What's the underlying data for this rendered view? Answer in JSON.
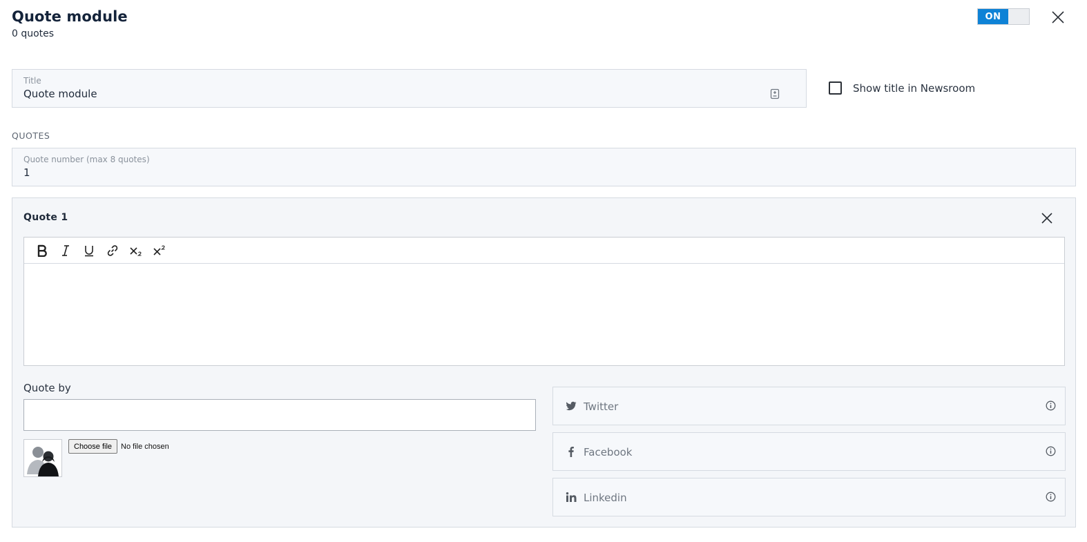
{
  "header": {
    "title": "Quote module",
    "subtitle": "0 quotes",
    "toggle_label": "ON"
  },
  "title_field": {
    "label": "Title",
    "value": "Quote module"
  },
  "show_title": {
    "label": "Show title in Newsroom",
    "checked": false
  },
  "quotes_section": {
    "label": "QUOTES",
    "number_field": {
      "label": "Quote number (max 8 quotes)",
      "value": "1"
    }
  },
  "quote": {
    "title": "Quote 1",
    "toolbar": [
      "bold-icon",
      "italic-icon",
      "underline-icon",
      "link-icon",
      "subscript-icon",
      "superscript-icon"
    ],
    "editor_text": "",
    "quote_by_label": "Quote by",
    "quote_by_value": "",
    "file": {
      "button": "Choose file",
      "status": "No file chosen"
    },
    "social": [
      {
        "name": "twitter",
        "placeholder": "Twitter"
      },
      {
        "name": "facebook",
        "placeholder": "Facebook"
      },
      {
        "name": "linkedin",
        "placeholder": "Linkedin"
      }
    ]
  },
  "colors": {
    "accent": "#0e82d6",
    "field_bg": "#f6f8fb",
    "panel_bg": "#f4f6f9",
    "border": "#d5dae1"
  }
}
